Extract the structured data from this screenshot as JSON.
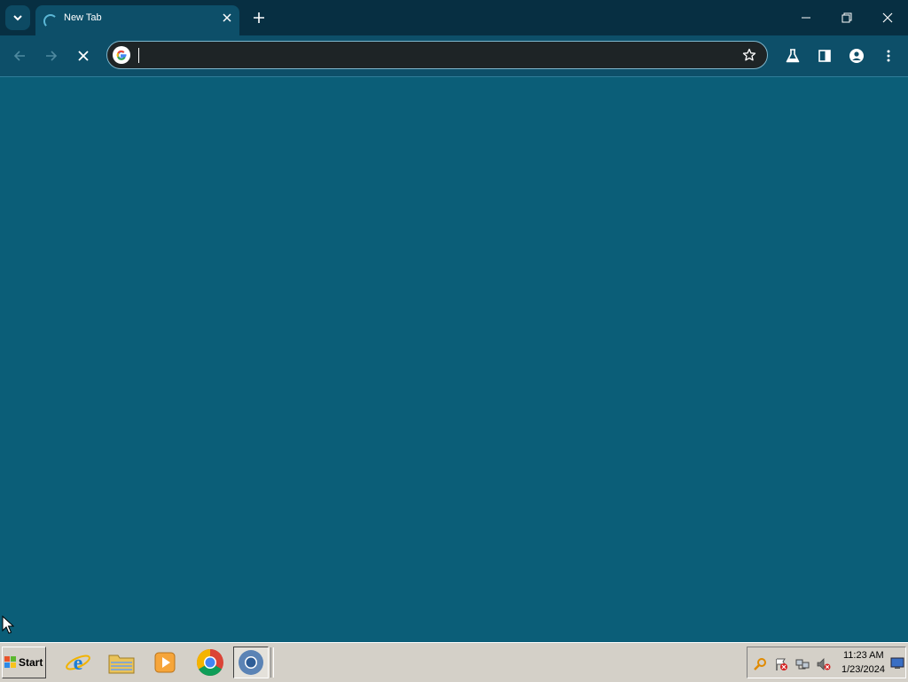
{
  "browser": {
    "tab": {
      "title": "New Tab"
    },
    "omnibox": {
      "value": "",
      "placeholder": ""
    },
    "colors": {
      "frame": "#072f42",
      "toolbar": "#0d4f69",
      "page_background": "#0b5e78",
      "omnibox_background": "#1e2426"
    },
    "icons": {
      "tab_search": "chevron-down-icon",
      "tab_loading": "loading-spinner-icon",
      "tab_close": "close-icon",
      "new_tab": "plus-icon",
      "minimize": "minimize-icon",
      "restore": "restore-icon",
      "close_window": "close-icon",
      "back": "arrow-left-icon",
      "forward": "arrow-right-icon",
      "stop": "close-icon",
      "site_info": "google-icon",
      "bookmark": "star-icon",
      "labs": "flask-icon",
      "side_panel": "side-panel-icon",
      "profile": "person-icon",
      "menu": "kebab-menu-icon"
    }
  },
  "taskbar": {
    "start_label": "Start",
    "apps": [
      {
        "name": "Internet Explorer",
        "icon": "internet-explorer-icon"
      },
      {
        "name": "Windows Explorer",
        "icon": "folder-icon"
      },
      {
        "name": "Media Player",
        "icon": "media-player-icon"
      },
      {
        "name": "Google Chrome",
        "icon": "chrome-icon"
      },
      {
        "name": "Chromium",
        "icon": "chromium-icon"
      }
    ],
    "tray": {
      "icons": [
        "search-key-icon",
        "flag-error-icon",
        "network-icon",
        "speaker-muted-icon"
      ],
      "time": "11:23 AM",
      "date": "1/23/2024",
      "show_desktop_icon": "show-desktop-icon"
    }
  }
}
